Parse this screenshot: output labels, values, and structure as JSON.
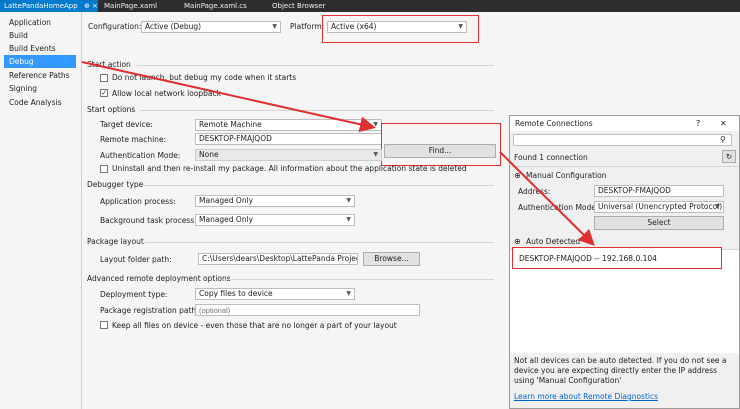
{
  "tabs": [
    {
      "label": "LattePandaHomeApp",
      "active": true,
      "pin": "⊕ ×"
    },
    {
      "label": "MainPage.xaml",
      "active": false
    },
    {
      "label": "MainPage.xaml.cs",
      "active": false
    },
    {
      "label": "Object Browser",
      "active": false
    }
  ],
  "nav": {
    "items": [
      "Application",
      "Build",
      "Build Events",
      "Debug",
      "Reference Paths",
      "Signing",
      "Code Analysis"
    ],
    "selected": "Debug"
  },
  "config": {
    "configuration_label": "Configuration:",
    "configuration_value": "Active (Debug)",
    "platform_label": "Platform:",
    "platform_value": "Active (x64)"
  },
  "start_action": {
    "title": "Start action",
    "no_launch_label": "Do not launch, but debug my code when it starts",
    "no_launch_checked": false,
    "loopback_label": "Allow local network loopback",
    "loopback_checked": true
  },
  "start_options": {
    "title": "Start options",
    "target_device_label": "Target device:",
    "target_device_value": "Remote Machine",
    "remote_machine_label": "Remote machine:",
    "remote_machine_value": "DESKTOP-FMAJQOD",
    "find_label": "Find...",
    "auth_mode_label": "Authentication Mode:",
    "auth_mode_value": "None",
    "uninstall_label": "Uninstall and then re-install my package. All information about the application state is deleted",
    "uninstall_checked": false
  },
  "debugger_type": {
    "title": "Debugger type",
    "app_process_label": "Application process:",
    "app_process_value": "Managed Only",
    "bg_task_label": "Background task process:",
    "bg_task_value": "Managed Only"
  },
  "package_layout": {
    "title": "Package layout",
    "layout_folder_label": "Layout folder path:",
    "layout_folder_value": "C:\\Users\\dears\\Desktop\\LattePanda Project\\La",
    "browse_label": "Browse..."
  },
  "advanced": {
    "title": "Advanced remote deployment options",
    "deployment_type_label": "Deployment type:",
    "deployment_type_value": "Copy files to device",
    "pkg_reg_label": "Package registration path:",
    "pkg_reg_placeholder": "(optional)",
    "keep_files_label": "Keep all files on device - even those that are no longer a part of your layout",
    "keep_files_checked": false
  },
  "dialog": {
    "title": "Remote Connections",
    "help": "?",
    "close": "✕",
    "search_value": "",
    "found_text": "Found 1 connection",
    "manual_title": "Manual Configuration",
    "address_label": "Address:",
    "address_value": "DESKTOP-FMAJQOD",
    "auth_mode_label": "Authentication Mode:",
    "auth_mode_value": "Universal (Unencrypted Protocol)",
    "select_label": "Select",
    "auto_title": "Auto Detected",
    "auto_item": "DESKTOP-FMAJQOD -- 192.168.0.104",
    "note": "Not all devices can be auto detected. If you do not see a device you are expecting directly enter the IP address using 'Manual Configuration'",
    "learn_more": "Learn more about Remote Diagnostics"
  },
  "colors": {
    "accent": "#007acc",
    "nav_selected": "#3399ff",
    "annotation_red": "#e03030",
    "link": "#0066cc"
  }
}
